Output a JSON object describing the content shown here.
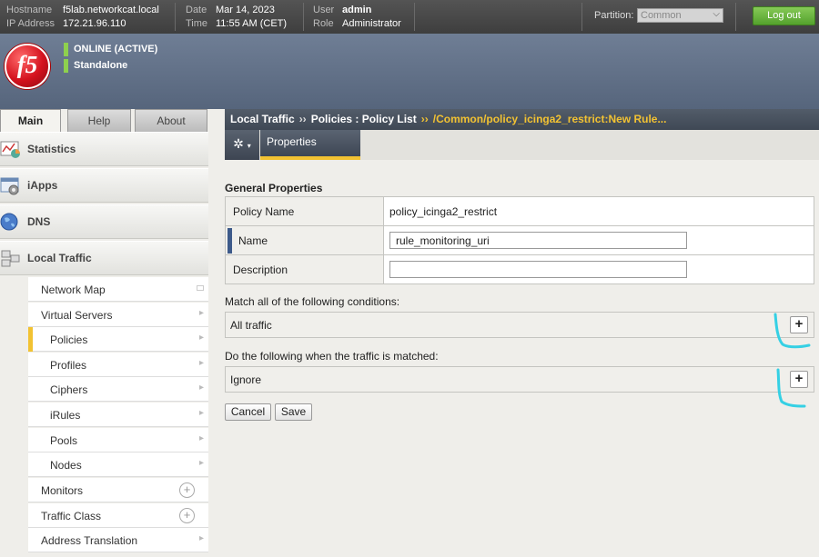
{
  "header": {
    "hostname_label": "Hostname",
    "hostname": "f5lab.networkcat.local",
    "ip_label": "IP Address",
    "ip": "172.21.96.110",
    "date_label": "Date",
    "date": "Mar 14, 2023",
    "time_label": "Time",
    "time": "11:55 AM (CET)",
    "user_label": "User",
    "user": "admin",
    "role_label": "Role",
    "role": "Administrator",
    "partition_label": "Partition:",
    "partition_value": "Common",
    "logout_label": "Log out"
  },
  "status": {
    "line1": "ONLINE (ACTIVE)",
    "line2": "Standalone"
  },
  "logo_text": "f5",
  "nav_tabs": [
    {
      "label": "Main"
    },
    {
      "label": "Help"
    },
    {
      "label": "About"
    }
  ],
  "sidebar": {
    "sections": [
      {
        "label": "Statistics",
        "icon": "statistics-icon"
      },
      {
        "label": "iApps",
        "icon": "iapps-icon"
      },
      {
        "label": "DNS",
        "icon": "dns-globe-icon"
      },
      {
        "label": "Local Traffic",
        "icon": "local-traffic-icon"
      }
    ],
    "items": [
      {
        "label": "Network Map"
      },
      {
        "label": "Virtual Servers"
      },
      {
        "label": "Policies"
      },
      {
        "label": "Profiles"
      },
      {
        "label": "Ciphers"
      },
      {
        "label": "iRules"
      },
      {
        "label": "Pools"
      },
      {
        "label": "Nodes"
      },
      {
        "label": "Monitors"
      },
      {
        "label": "Traffic Class"
      },
      {
        "label": "Address Translation"
      }
    ]
  },
  "breadcrumb": {
    "part1": "Local Traffic",
    "sep": "››",
    "part2": "Policies : Policy List",
    "current": "/Common/policy_icinga2_restrict:New Rule..."
  },
  "tabs": {
    "gear": "✲",
    "properties": "Properties"
  },
  "form": {
    "section_title": "General Properties",
    "policy_name_label": "Policy Name",
    "policy_name_value": "policy_icinga2_restrict",
    "name_label": "Name",
    "name_value": "rule_monitoring_uri",
    "description_label": "Description",
    "description_value": "",
    "conditions_label": "Match all of the following conditions:",
    "conditions_value": "All traffic",
    "actions_label": "Do the following when the traffic is matched:",
    "actions_value": "Ignore",
    "add_symbol": "+",
    "cancel_label": "Cancel",
    "save_label": "Save"
  },
  "colors": {
    "accent_yellow": "#f2c232",
    "logout_green": "#54a22d",
    "annotation_cyan": "#35d0e4"
  }
}
